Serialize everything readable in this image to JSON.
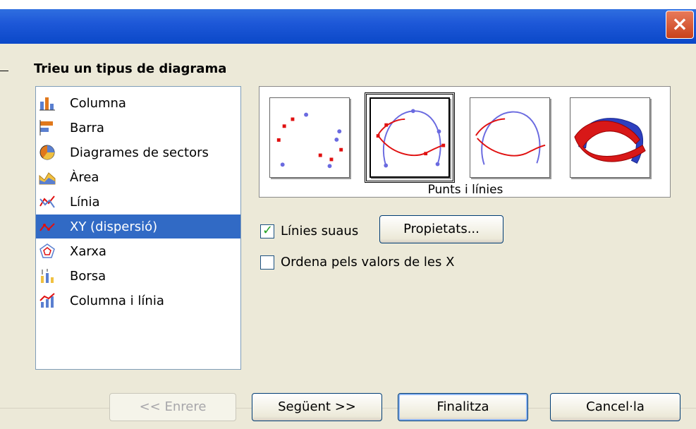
{
  "window": {
    "close_glyph": "×"
  },
  "heading": "Trieu un tipus de diagrama",
  "chart_types": [
    {
      "label": "Columna",
      "icon": "column-chart-icon"
    },
    {
      "label": "Barra",
      "icon": "bar-chart-icon"
    },
    {
      "label": "Diagrames de sectors",
      "icon": "pie-chart-icon"
    },
    {
      "label": "Àrea",
      "icon": "area-chart-icon"
    },
    {
      "label": "Línia",
      "icon": "line-chart-icon"
    },
    {
      "label": "XY (dispersió)",
      "icon": "xy-scatter-icon",
      "selected": true
    },
    {
      "label": "Xarxa",
      "icon": "net-chart-icon"
    },
    {
      "label": "Borsa",
      "icon": "stock-chart-icon"
    },
    {
      "label": "Columna i línia",
      "icon": "column-line-chart-icon"
    }
  ],
  "variants": {
    "caption": "Punts i línies",
    "selected_index": 1
  },
  "options": {
    "smooth_lines": {
      "label": "Línies suaus",
      "checked": true
    },
    "properties_button": "Propietats...",
    "sort_by_x": {
      "label": "Ordena pels valors de les X",
      "checked": false
    }
  },
  "buttons": {
    "back": "<< Enrere",
    "next": "Següent >>",
    "finish": "Finalitza",
    "cancel": "Cancel·la"
  },
  "colors": {
    "selection": "#316ac5",
    "series_red": "#e01010",
    "series_blue": "#6a6ae0"
  }
}
